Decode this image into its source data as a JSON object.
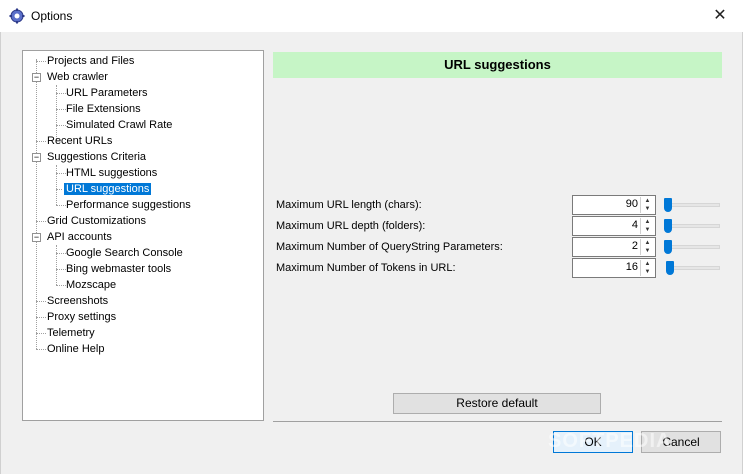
{
  "window": {
    "title": "Options",
    "close_glyph": "✕",
    "icon": "gear-icon"
  },
  "tree": {
    "items": [
      {
        "label": "Projects and Files"
      },
      {
        "label": "Web crawler",
        "expander": "−"
      },
      {
        "label": "URL Parameters"
      },
      {
        "label": "File Extensions"
      },
      {
        "label": "Simulated Crawl Rate"
      },
      {
        "label": "Recent URLs"
      },
      {
        "label": "Suggestions Criteria",
        "expander": "−"
      },
      {
        "label": "HTML suggestions"
      },
      {
        "label": "URL suggestions",
        "selected": true
      },
      {
        "label": "Performance suggestions"
      },
      {
        "label": "Grid Customizations"
      },
      {
        "label": "API accounts",
        "expander": "−"
      },
      {
        "label": "Google Search Console"
      },
      {
        "label": "Bing webmaster tools"
      },
      {
        "label": "Mozscape"
      },
      {
        "label": "Screenshots"
      },
      {
        "label": "Proxy settings"
      },
      {
        "label": "Telemetry"
      },
      {
        "label": "Online Help"
      }
    ]
  },
  "panel": {
    "header": "URL suggestions",
    "settings": [
      {
        "label": "Maximum URL length (chars):",
        "value": "90",
        "slider_level": 0.0
      },
      {
        "label": "Maximum URL depth (folders):",
        "value": "4",
        "slider_level": 0.0
      },
      {
        "label": "Maximum Number of QueryString Parameters:",
        "value": "2",
        "slider_level": 0.0
      },
      {
        "label": "Maximum Number of Tokens in URL:",
        "value": "16",
        "slider_level": 0.05
      }
    ],
    "restore_label": "Restore default"
  },
  "footer": {
    "ok_label": "OK",
    "cancel_label": "Cancel"
  },
  "spin_up": "▲",
  "spin_down": "▼",
  "watermark": "SOFTPEDIA",
  "colors": {
    "header_bg": "#c6f5c6",
    "selection": "#0078d7",
    "slider_thumb": "#0078d7"
  }
}
